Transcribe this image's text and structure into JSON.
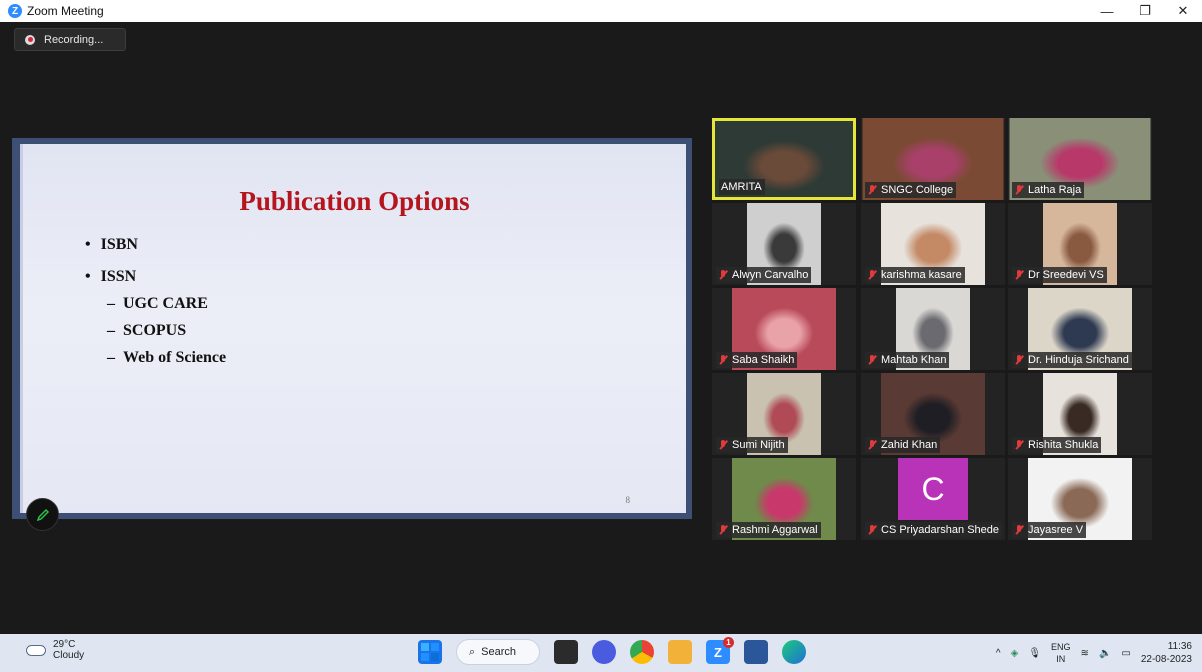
{
  "window": {
    "title": "Zoom Meeting",
    "app_icon": "Z",
    "minimize": "—",
    "restore": "❐",
    "close": "✕"
  },
  "recording": {
    "label": "Recording..."
  },
  "slide": {
    "title": "Publication Options",
    "bullets": [
      "ISBN",
      "ISSN"
    ],
    "sub_bullets": [
      "UGC CARE",
      "SCOPUS",
      "Web of Science"
    ],
    "page_number": "8"
  },
  "participants": [
    {
      "name": "AMRITA",
      "muted": false,
      "active": true,
      "bg": "#2e3a36",
      "fg": "#6a4a38"
    },
    {
      "name": "SNGC College",
      "muted": true,
      "active": false,
      "bg": "#7b4a34",
      "fg": "#a8406a"
    },
    {
      "name": "Latha Raja",
      "muted": true,
      "active": false,
      "bg": "#8a8f78",
      "fg": "#b8386a"
    },
    {
      "name": "Alwyn Carvalho",
      "muted": true,
      "active": false,
      "bg": "#cfcfcf",
      "fg": "#3a3a3a"
    },
    {
      "name": "karishma kasare",
      "muted": true,
      "active": false,
      "bg": "#e7e2dc",
      "fg": "#c48a66"
    },
    {
      "name": "Dr Sreedevi VS",
      "muted": true,
      "active": false,
      "bg": "#d6b79c",
      "fg": "#8a5a40"
    },
    {
      "name": "Saba Shaikh",
      "muted": true,
      "active": false,
      "bg": "#b84a5a",
      "fg": "#e8a2a8"
    },
    {
      "name": "Mahtab Khan",
      "muted": true,
      "active": false,
      "bg": "#dad8d4",
      "fg": "#6a6a70"
    },
    {
      "name": "Dr. Hinduja Srichand",
      "muted": true,
      "active": false,
      "bg": "#dcd6c8",
      "fg": "#2e3a52"
    },
    {
      "name": "Sumi Nijith",
      "muted": true,
      "active": false,
      "bg": "#c9c2b0",
      "fg": "#b04a55"
    },
    {
      "name": "Zahid Khan",
      "muted": true,
      "active": false,
      "bg": "#5a3a34",
      "fg": "#1e1e24"
    },
    {
      "name": "Rishita Shukla",
      "muted": true,
      "active": false,
      "bg": "#e7e2dc",
      "fg": "#3a2a24"
    },
    {
      "name": "Rashmi Aggarwal",
      "muted": true,
      "active": false,
      "bg": "#6f8a4a",
      "fg": "#c8386a"
    },
    {
      "name": "CS Priyadarshan Shede",
      "muted": true,
      "active": false,
      "bg": "#b933b8",
      "fg": "#b933b8",
      "initial": "C"
    },
    {
      "name": "Jayasree V",
      "muted": true,
      "active": false,
      "bg": "#f2f2f2",
      "fg": "#8a6a56"
    }
  ],
  "taskbar": {
    "weather_temp": "29°C",
    "weather_desc": "Cloudy",
    "search_label": "Search",
    "lang_top": "ENG",
    "lang_bottom": "IN",
    "time": "11:36",
    "date": "22-08-2023",
    "zoom_badge": "1"
  }
}
